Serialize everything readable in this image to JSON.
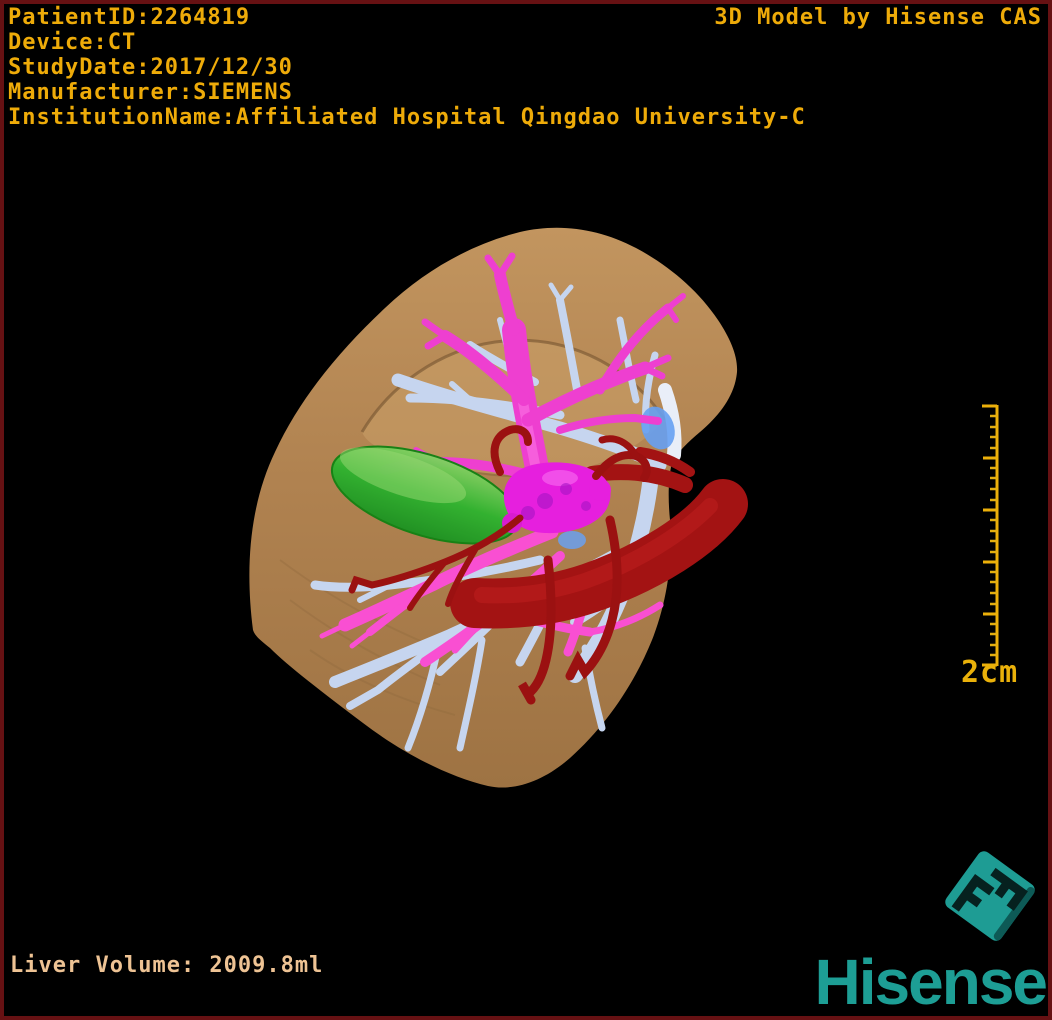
{
  "header": {
    "lines": [
      "PatientID:2264819",
      "Device:CT",
      "StudyDate:2017/12/30",
      "Manufacturer:SIEMENS",
      "InstitutionName:Affiliated Hospital Qingdao University-C"
    ]
  },
  "watermark": "3D Model by Hisense CAS",
  "scale_bar": {
    "label": "2cm"
  },
  "footer": {
    "liver_volume": "Liver Volume: 2009.8ml"
  },
  "logo": {
    "wordmark": "Hisense"
  },
  "model": {
    "structures": [
      {
        "name": "liver",
        "color": "#b58852"
      },
      {
        "name": "hepatic-veins",
        "color": "#c6d5ef"
      },
      {
        "name": "portal-veins",
        "color": "#ee3fd0"
      },
      {
        "name": "hepatic-artery",
        "color": "#a31313"
      },
      {
        "name": "gallbladder",
        "color": "#2fb32f"
      },
      {
        "name": "tumor",
        "color": "#e61fde"
      }
    ]
  },
  "colors": {
    "overlay_text": "#eeab09",
    "footer_text": "#eec394",
    "scale_gold": "#ecb00a",
    "brand_teal": "#1d9e95",
    "frame_border": "#661113",
    "background": "#000000"
  }
}
